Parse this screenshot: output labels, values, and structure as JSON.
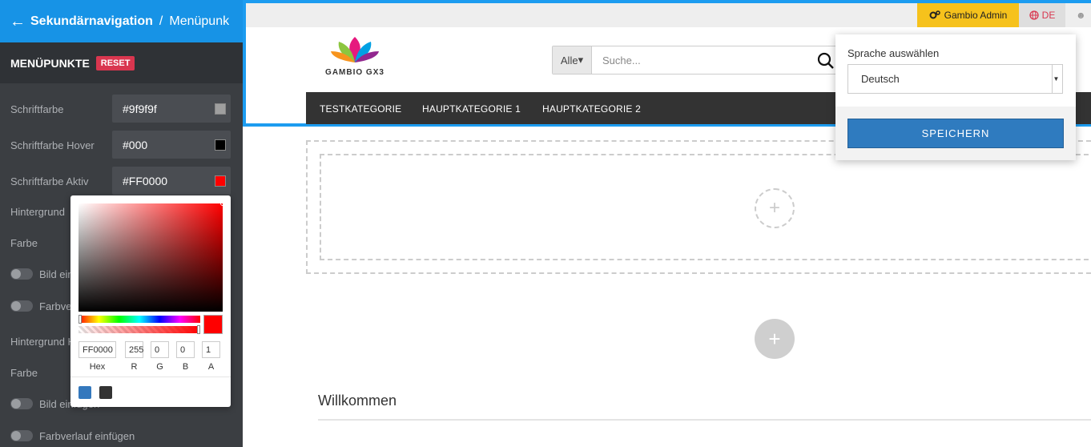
{
  "header": {
    "back_icon": "arrow-left-icon",
    "title": "Sekundärnavigation",
    "separator": "/",
    "subtitle": "Menüpunk"
  },
  "section": {
    "label": "MENÜPUNKTE",
    "reset_label": "RESET"
  },
  "fields": {
    "schriftfarbe_label": "Schriftfarbe",
    "schriftfarbe_value": "#9f9f9f",
    "schriftfarbe_color": "#9f9f9f",
    "hover_label": "Schriftfarbe Hover",
    "hover_value": "#000",
    "hover_color": "#000000",
    "aktiv_label": "Schriftfarbe Aktiv",
    "aktiv_value": "#FF0000",
    "aktiv_color": "#FF0000",
    "hintergrund_label": "Hintergrund",
    "farbe_label": "Farbe",
    "bild1_label": "Bild ein",
    "farbverlauf1_label": "Farbve",
    "hintergrund_hover_label": "Hintergrund H",
    "farbe2_label": "Farbe",
    "bild2_label": "Bild einfügen",
    "farbverlauf2_label": "Farbverlauf einfügen"
  },
  "picker": {
    "hex": "FF0000",
    "r": "255",
    "g": "0",
    "b": "0",
    "a": "1",
    "hex_label": "Hex",
    "r_label": "R",
    "g_label": "G",
    "b_label": "B",
    "a_label": "A",
    "preset1": "#3478bd",
    "preset2": "#333333"
  },
  "topbar": {
    "admin_label": "Gambio Admin",
    "lang_label": "DE"
  },
  "logo": {
    "text": "GAMBIO GX3"
  },
  "search": {
    "category": "Alle",
    "placeholder": "Suche..."
  },
  "nav": {
    "items": [
      {
        "label": "TESTKATEGORIE"
      },
      {
        "label": "HAUPTKATEGORIE 1"
      },
      {
        "label": "HAUPTKATEGORIE 2"
      }
    ]
  },
  "content": {
    "welcome": "Willkommen"
  },
  "lang_dropdown": {
    "title": "Sprache auswählen",
    "selected": "Deutsch",
    "save_label": "SPEICHERN"
  }
}
